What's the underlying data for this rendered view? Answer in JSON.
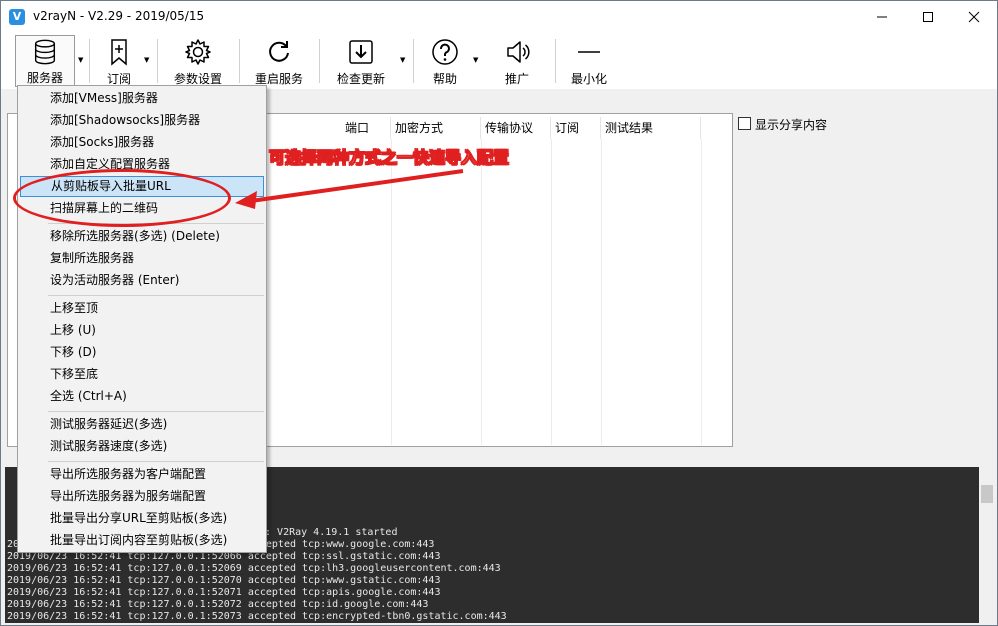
{
  "window": {
    "title": "v2rayN - V2.29 - 2019/05/15",
    "app_icon_glyph": "V"
  },
  "toolbar": {
    "buttons": [
      {
        "label": "服务器",
        "icon": "database-icon"
      },
      {
        "label": "订阅",
        "icon": "bookmark-add-icon"
      },
      {
        "label": "参数设置",
        "icon": "gear-icon"
      },
      {
        "label": "重启服务",
        "icon": "restart-icon"
      },
      {
        "label": "检查更新",
        "icon": "download-icon"
      },
      {
        "label": "帮助",
        "icon": "help-icon"
      },
      {
        "label": "推广",
        "icon": "speaker-icon"
      },
      {
        "label": "最小化",
        "icon": "minimize-line-icon"
      }
    ]
  },
  "grid": {
    "columns": [
      "端口",
      "加密方式",
      "传输协议",
      "订阅",
      "测试结果"
    ]
  },
  "share_checkbox": {
    "label": "显示分享内容",
    "checked": false
  },
  "menu": {
    "items": [
      "添加[VMess]服务器",
      "添加[Shadowsocks]服务器",
      "添加[Socks]服务器",
      "添加自定义配置服务器",
      "从剪贴板导入批量URL",
      "扫描屏幕上的二维码",
      "移除所选服务器(多选)   (Delete)",
      "复制所选服务器",
      "设为活动服务器   (Enter)",
      "上移至顶",
      "上移        (U)",
      "下移        (D)",
      "下移至底",
      "全选        (Ctrl+A)",
      "测试服务器延迟(多选)",
      "测试服务器速度(多选)",
      "导出所选服务器为客户端配置",
      "导出所选服务器为服务端配置",
      "批量导出分享URL至剪贴板(多选)",
      "批量导出订阅内容至剪贴板(多选)"
    ],
    "highlighted_index": 4
  },
  "annotation": {
    "text": "可选择两种方式之一快速导入配置",
    "color": "#e02020"
  },
  "log": {
    "lines": [
      "e: V2Ray 4.19.1 started",
      "2019/06/23 16:52:41 tcp:127.0.0.1:52068 accepted tcp:www.google.com:443",
      "2019/06/23 16:52:41 tcp:127.0.0.1:52066 accepted tcp:ssl.gstatic.com:443",
      "2019/06/23 16:52:41 tcp:127.0.0.1:52069 accepted tcp:lh3.googleusercontent.com:443",
      "2019/06/23 16:52:41 tcp:127.0.0.1:52070 accepted tcp:www.gstatic.com:443",
      "2019/06/23 16:52:41 tcp:127.0.0.1:52071 accepted tcp:apis.google.com:443",
      "2019/06/23 16:52:41 tcp:127.0.0.1:52072 accepted tcp:id.google.com:443",
      "2019/06/23 16:52:41 tcp:127.0.0.1:52073 accepted tcp:encrypted-tbn0.gstatic.com:443"
    ]
  }
}
